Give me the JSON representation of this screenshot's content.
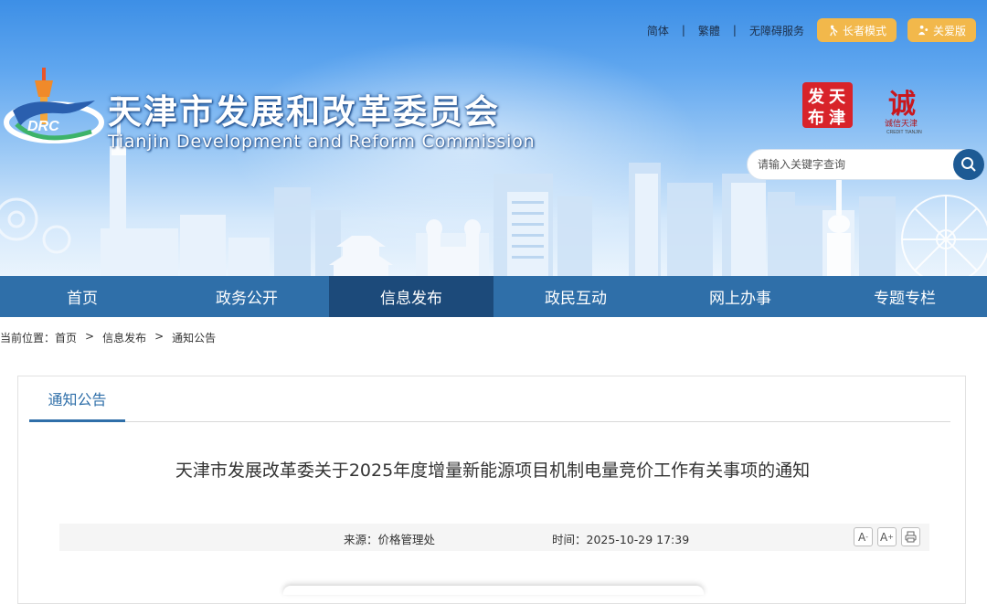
{
  "header": {
    "links": [
      "简体",
      "繁體",
      "无障碍服务"
    ],
    "elder_mode": "长者模式",
    "care_version": "关爱版",
    "site_title": "天津市发展和改革委员会",
    "site_subtitle": "Tianjin Development and Reform Commission",
    "logo_text": "DRC",
    "badge_text": [
      "天",
      "津",
      "发",
      "布"
    ],
    "credit_text": "诚信天津",
    "credit_sub": "CREDIT TIANJIN"
  },
  "search": {
    "placeholder": "请输入关键字查询",
    "icon": "search-icon"
  },
  "nav": {
    "items": [
      "首页",
      "政务公开",
      "信息发布",
      "政民互动",
      "网上办事",
      "专题专栏"
    ],
    "active_index": 2
  },
  "breadcrumb": {
    "prefix": "当前位置：",
    "items": [
      "首页",
      "信息发布",
      "通知公告"
    ],
    "separator": ">"
  },
  "article": {
    "tab": "通知公告",
    "title": "天津市发展改革委关于2025年度增量新能源项目机制电量竞价工作有关事项的通知",
    "source_label": "来源：价格管理处",
    "time_label": "时间：2025-10-29 17:39",
    "tools": [
      "A-",
      "A+",
      "print-icon"
    ]
  },
  "colors": {
    "nav": "#2f6fa9",
    "nav_active": "#1c4a7a",
    "pill": "#f2b84b",
    "search_btn": "#1d5a94"
  }
}
